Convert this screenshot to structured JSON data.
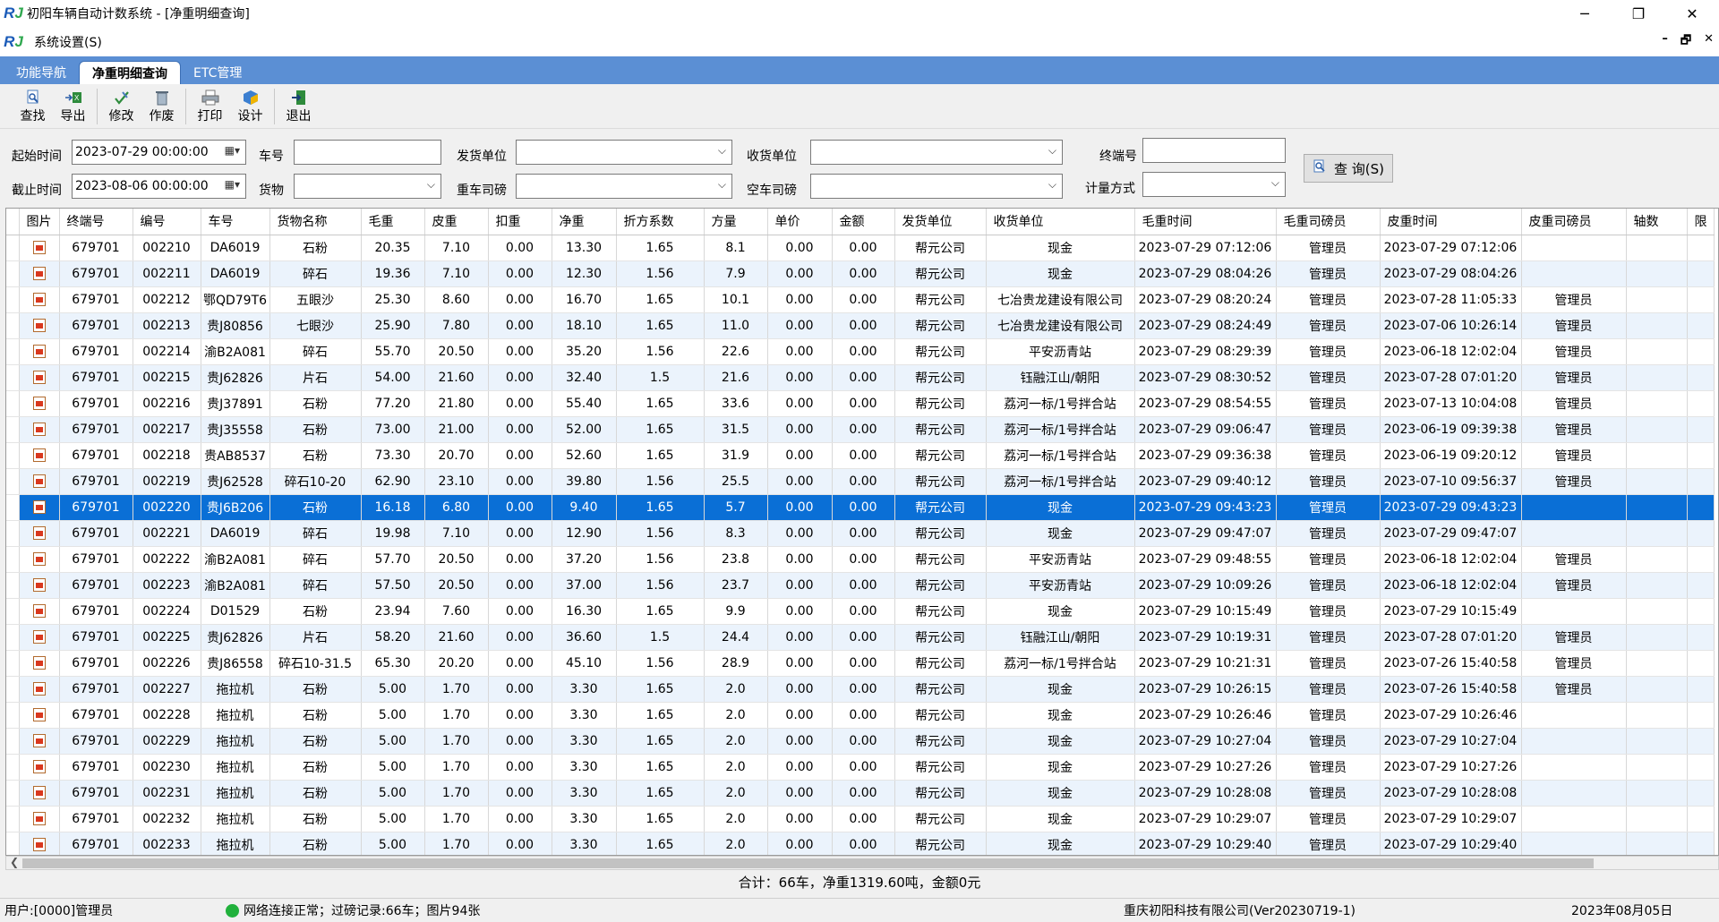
{
  "window": {
    "title": "初阳车辆自动计数系统 - [净重明细查询]",
    "logo_main": "R",
    "logo_accent": "J",
    "minimize": "─",
    "restore": "❐",
    "close": "✕"
  },
  "menubar": {
    "settings": "系统设置(S)",
    "mdi_min": "–",
    "mdi_restore": "🗗",
    "mdi_close": "✕"
  },
  "tabs": [
    {
      "label": "功能导航",
      "active": false
    },
    {
      "label": "净重明细查询",
      "active": true
    },
    {
      "label": "ETC管理",
      "active": false
    }
  ],
  "toolbar": {
    "find": "查找",
    "export": "导出",
    "modify": "修改",
    "void": "作废",
    "print": "打印",
    "design": "设计",
    "exit": "退出"
  },
  "filters": {
    "start_time_label": "起始时间",
    "start_time_value": "2023-07-29 00:00:00",
    "end_time_label": "截止时间",
    "end_time_value": "2023-08-06 00:00:00",
    "plate_label": "车号",
    "plate_value": "",
    "goods_label": "货物",
    "goods_value": "",
    "sender_label": "发货单位",
    "sender_value": "",
    "gross_operator_label": "重车司磅",
    "gross_operator_value": "",
    "receiver_label": "收货单位",
    "receiver_value": "",
    "tare_operator_label": "空车司磅",
    "tare_operator_value": "",
    "terminal_label": "终端号",
    "terminal_value": "",
    "method_label": "计量方式",
    "method_value": "",
    "query_button": "查 询(S)"
  },
  "grid": {
    "columns": [
      "图片",
      "终端号",
      "编号",
      "车号",
      "货物名称",
      "毛重",
      "皮重",
      "扣重",
      "净重",
      "折方系数",
      "方量",
      "单价",
      "金额",
      "发货单位",
      "收货单位",
      "毛重时间",
      "毛重司磅员",
      "皮重时间",
      "皮重司磅员",
      "轴数",
      "限"
    ],
    "selected_index": 10,
    "rows": [
      [
        "679701",
        "002210",
        "DA6019",
        "石粉",
        "20.35",
        "7.10",
        "0.00",
        "13.30",
        "1.65",
        "8.1",
        "0.00",
        "0.00",
        "帮元公司",
        "现金",
        "2023-07-29 07:12:06",
        "管理员",
        "2023-07-29 07:12:06",
        "",
        ""
      ],
      [
        "679701",
        "002211",
        "DA6019",
        "碎石",
        "19.36",
        "7.10",
        "0.00",
        "12.30",
        "1.56",
        "7.9",
        "0.00",
        "0.00",
        "帮元公司",
        "现金",
        "2023-07-29 08:04:26",
        "管理员",
        "2023-07-29 08:04:26",
        "",
        ""
      ],
      [
        "679701",
        "002212",
        "鄂QD79T6",
        "五眼沙",
        "25.30",
        "8.60",
        "0.00",
        "16.70",
        "1.65",
        "10.1",
        "0.00",
        "0.00",
        "帮元公司",
        "七冶贵龙建设有限公司",
        "2023-07-29 08:20:24",
        "管理员",
        "2023-07-28 11:05:33",
        "管理员",
        ""
      ],
      [
        "679701",
        "002213",
        "贵J80856",
        "七眼沙",
        "25.90",
        "7.80",
        "0.00",
        "18.10",
        "1.65",
        "11.0",
        "0.00",
        "0.00",
        "帮元公司",
        "七冶贵龙建设有限公司",
        "2023-07-29 08:24:49",
        "管理员",
        "2023-07-06 10:26:14",
        "管理员",
        ""
      ],
      [
        "679701",
        "002214",
        "渝B2A081",
        "碎石",
        "55.70",
        "20.50",
        "0.00",
        "35.20",
        "1.56",
        "22.6",
        "0.00",
        "0.00",
        "帮元公司",
        "平安沥青站",
        "2023-07-29 08:29:39",
        "管理员",
        "2023-06-18 12:02:04",
        "管理员",
        ""
      ],
      [
        "679701",
        "002215",
        "贵J62826",
        "片石",
        "54.00",
        "21.60",
        "0.00",
        "32.40",
        "1.5",
        "21.6",
        "0.00",
        "0.00",
        "帮元公司",
        "钰融江山/朝阳",
        "2023-07-29 08:30:52",
        "管理员",
        "2023-07-28 07:01:20",
        "管理员",
        ""
      ],
      [
        "679701",
        "002216",
        "贵J37891",
        "石粉",
        "77.20",
        "21.80",
        "0.00",
        "55.40",
        "1.65",
        "33.6",
        "0.00",
        "0.00",
        "帮元公司",
        "荔河一标/1号拌合站",
        "2023-07-29 08:54:55",
        "管理员",
        "2023-07-13 10:04:08",
        "管理员",
        ""
      ],
      [
        "679701",
        "002217",
        "贵J35558",
        "石粉",
        "73.00",
        "21.00",
        "0.00",
        "52.00",
        "1.65",
        "31.5",
        "0.00",
        "0.00",
        "帮元公司",
        "荔河一标/1号拌合站",
        "2023-07-29 09:06:47",
        "管理员",
        "2023-06-19 09:39:38",
        "管理员",
        ""
      ],
      [
        "679701",
        "002218",
        "贵AB8537",
        "石粉",
        "73.30",
        "20.70",
        "0.00",
        "52.60",
        "1.65",
        "31.9",
        "0.00",
        "0.00",
        "帮元公司",
        "荔河一标/1号拌合站",
        "2023-07-29 09:36:38",
        "管理员",
        "2023-06-19 09:20:12",
        "管理员",
        ""
      ],
      [
        "679701",
        "002219",
        "贵J62528",
        "碎石10-20",
        "62.90",
        "23.10",
        "0.00",
        "39.80",
        "1.56",
        "25.5",
        "0.00",
        "0.00",
        "帮元公司",
        "荔河一标/1号拌合站",
        "2023-07-29 09:40:12",
        "管理员",
        "2023-07-10 09:56:37",
        "管理员",
        ""
      ],
      [
        "679701",
        "002220",
        "贵J6B206",
        "石粉",
        "16.18",
        "6.80",
        "0.00",
        "9.40",
        "1.65",
        "5.7",
        "0.00",
        "0.00",
        "帮元公司",
        "现金",
        "2023-07-29 09:43:23",
        "管理员",
        "2023-07-29 09:43:23",
        "",
        ""
      ],
      [
        "679701",
        "002221",
        "DA6019",
        "碎石",
        "19.98",
        "7.10",
        "0.00",
        "12.90",
        "1.56",
        "8.3",
        "0.00",
        "0.00",
        "帮元公司",
        "现金",
        "2023-07-29 09:47:07",
        "管理员",
        "2023-07-29 09:47:07",
        "",
        ""
      ],
      [
        "679701",
        "002222",
        "渝B2A081",
        "碎石",
        "57.70",
        "20.50",
        "0.00",
        "37.20",
        "1.56",
        "23.8",
        "0.00",
        "0.00",
        "帮元公司",
        "平安沥青站",
        "2023-07-29 09:48:55",
        "管理员",
        "2023-06-18 12:02:04",
        "管理员",
        ""
      ],
      [
        "679701",
        "002223",
        "渝B2A081",
        "碎石",
        "57.50",
        "20.50",
        "0.00",
        "37.00",
        "1.56",
        "23.7",
        "0.00",
        "0.00",
        "帮元公司",
        "平安沥青站",
        "2023-07-29 10:09:26",
        "管理员",
        "2023-06-18 12:02:04",
        "管理员",
        ""
      ],
      [
        "679701",
        "002224",
        "D01529",
        "石粉",
        "23.94",
        "7.60",
        "0.00",
        "16.30",
        "1.65",
        "9.9",
        "0.00",
        "0.00",
        "帮元公司",
        "现金",
        "2023-07-29 10:15:49",
        "管理员",
        "2023-07-29 10:15:49",
        "",
        ""
      ],
      [
        "679701",
        "002225",
        "贵J62826",
        "片石",
        "58.20",
        "21.60",
        "0.00",
        "36.60",
        "1.5",
        "24.4",
        "0.00",
        "0.00",
        "帮元公司",
        "钰融江山/朝阳",
        "2023-07-29 10:19:31",
        "管理员",
        "2023-07-28 07:01:20",
        "管理员",
        ""
      ],
      [
        "679701",
        "002226",
        "贵J86558",
        "碎石10-31.5",
        "65.30",
        "20.20",
        "0.00",
        "45.10",
        "1.56",
        "28.9",
        "0.00",
        "0.00",
        "帮元公司",
        "荔河一标/1号拌合站",
        "2023-07-29 10:21:31",
        "管理员",
        "2023-07-26 15:40:58",
        "管理员",
        ""
      ],
      [
        "679701",
        "002227",
        "拖拉机",
        "石粉",
        "5.00",
        "1.70",
        "0.00",
        "3.30",
        "1.65",
        "2.0",
        "0.00",
        "0.00",
        "帮元公司",
        "现金",
        "2023-07-29 10:26:15",
        "管理员",
        "2023-07-26 15:40:58",
        "管理员",
        ""
      ],
      [
        "679701",
        "002228",
        "拖拉机",
        "石粉",
        "5.00",
        "1.70",
        "0.00",
        "3.30",
        "1.65",
        "2.0",
        "0.00",
        "0.00",
        "帮元公司",
        "现金",
        "2023-07-29 10:26:46",
        "管理员",
        "2023-07-29 10:26:46",
        "",
        ""
      ],
      [
        "679701",
        "002229",
        "拖拉机",
        "石粉",
        "5.00",
        "1.70",
        "0.00",
        "3.30",
        "1.65",
        "2.0",
        "0.00",
        "0.00",
        "帮元公司",
        "现金",
        "2023-07-29 10:27:04",
        "管理员",
        "2023-07-29 10:27:04",
        "",
        ""
      ],
      [
        "679701",
        "002230",
        "拖拉机",
        "石粉",
        "5.00",
        "1.70",
        "0.00",
        "3.30",
        "1.65",
        "2.0",
        "0.00",
        "0.00",
        "帮元公司",
        "现金",
        "2023-07-29 10:27:26",
        "管理员",
        "2023-07-29 10:27:26",
        "",
        ""
      ],
      [
        "679701",
        "002231",
        "拖拉机",
        "石粉",
        "5.00",
        "1.70",
        "0.00",
        "3.30",
        "1.65",
        "2.0",
        "0.00",
        "0.00",
        "帮元公司",
        "现金",
        "2023-07-29 10:28:08",
        "管理员",
        "2023-07-29 10:28:08",
        "",
        ""
      ],
      [
        "679701",
        "002232",
        "拖拉机",
        "石粉",
        "5.00",
        "1.70",
        "0.00",
        "3.30",
        "1.65",
        "2.0",
        "0.00",
        "0.00",
        "帮元公司",
        "现金",
        "2023-07-29 10:29:07",
        "管理员",
        "2023-07-29 10:29:07",
        "",
        ""
      ],
      [
        "679701",
        "002233",
        "拖拉机",
        "石粉",
        "5.00",
        "1.70",
        "0.00",
        "3.30",
        "1.65",
        "2.0",
        "0.00",
        "0.00",
        "帮元公司",
        "现金",
        "2023-07-29 10:29:40",
        "管理员",
        "2023-07-29 10:29:40",
        "",
        ""
      ]
    ]
  },
  "summary": "合计：66车，净重1319.60吨，金额0元",
  "statusbar": {
    "user": "用户:[0000]管理员",
    "network": "网络连接正常；过磅记录:66车；图片94张",
    "company": "重庆初阳科技有限公司(Ver20230719-1)",
    "date": "2023年08月05日"
  },
  "colors": {
    "selected_row": "#0a6fd6",
    "alt_row": "#ebf3fc",
    "tab_strip": "#5b8fd4",
    "status_ok": "#21b13c"
  }
}
